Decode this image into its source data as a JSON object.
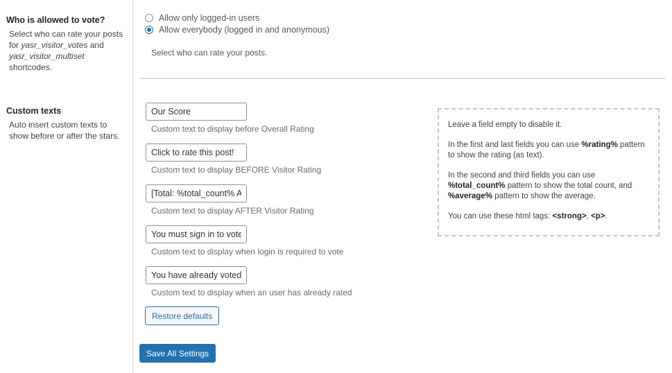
{
  "vote_section": {
    "title": "Who is allowed to vote?",
    "desc_prefix": "Select who can rate your posts for ",
    "shortcode_1": "yasr_visitor_votes",
    "desc_and": " and ",
    "shortcode_2": "yasr_visitor_multiset",
    "desc_suffix": " shortcodes.",
    "options": [
      {
        "label": "Allow only logged-in users",
        "selected": false
      },
      {
        "label": "Allow everybody (logged in and anonymous)",
        "selected": true
      }
    ],
    "help": "Select who can rate your posts."
  },
  "texts_section": {
    "title": "Custom texts",
    "desc": "Auto insert custom texts to show before or after the stars.",
    "fields": [
      {
        "value": "Our Score",
        "desc": "Custom text to display before Overall Rating"
      },
      {
        "value": "Click to rate this post!",
        "desc": "Custom text to display BEFORE Visitor Rating"
      },
      {
        "value": "[Total: %total_count% Average: %average%]",
        "desc": "Custom text to display AFTER Visitor Rating"
      },
      {
        "value": "You must sign in to vote",
        "desc": "Custom text to display when login is required to vote"
      },
      {
        "value": "You have already voted for this article",
        "desc": "Custom text to display when an user has already rated"
      }
    ],
    "restore_label": "Restore defaults"
  },
  "info_box": {
    "line1": "Leave a field empty to disable it.",
    "line2_a": "In the first and last fields you can use ",
    "line2_b": "%rating%",
    "line2_c": " pattern to show the rating (as text).",
    "line3_a": "In the second and third fields you can use ",
    "line3_b": "%total_count%",
    "line3_c": " pattern to show the total count, and ",
    "line3_d": "%average%",
    "line3_e": " pattern to show the average.",
    "line4_a": "You can use these html tags: ",
    "line4_b": "<strong>",
    "line4_c": ", ",
    "line4_d": "<p>",
    "line4_e": "."
  },
  "save_label": "Save All Settings"
}
